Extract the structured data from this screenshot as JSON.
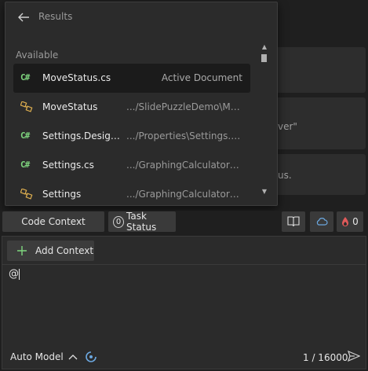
{
  "popup": {
    "title": "Results",
    "section": "Available",
    "items": [
      {
        "icon": "C#",
        "name": "MoveStatus.cs",
        "path": "Active Document",
        "selected": true
      },
      {
        "icon": "class",
        "name": "MoveStatus",
        "path": ".../SlidePuzzleDemo\\Move...",
        "selected": false
      },
      {
        "icon": "C#",
        "name": "Settings.Designe...",
        "path": ".../Properties\\Settings.Desi...",
        "selected": false
      },
      {
        "icon": "C#",
        "name": "Settings.cs",
        "path": ".../GraphingCalculatorDe...",
        "selected": false
      },
      {
        "icon": "class",
        "name": "Settings",
        "path": ".../GraphingCalculatorDe...",
        "selected": false
      }
    ]
  },
  "background": {
    "card2_text": "ver\"",
    "card3_text": "us."
  },
  "toolbar": {
    "code_context": "Code Context",
    "task_count": "0",
    "task_status": "Task Status",
    "flame_count": "0"
  },
  "composer": {
    "add_context": "Add Context",
    "prompt_value": "@",
    "model": "Auto Model",
    "counter": "1 / 16000"
  },
  "colors": {
    "accent_green": "#7fd67f",
    "flame_red": "#e05a5a",
    "cloud_blue": "#6ca8e0"
  }
}
